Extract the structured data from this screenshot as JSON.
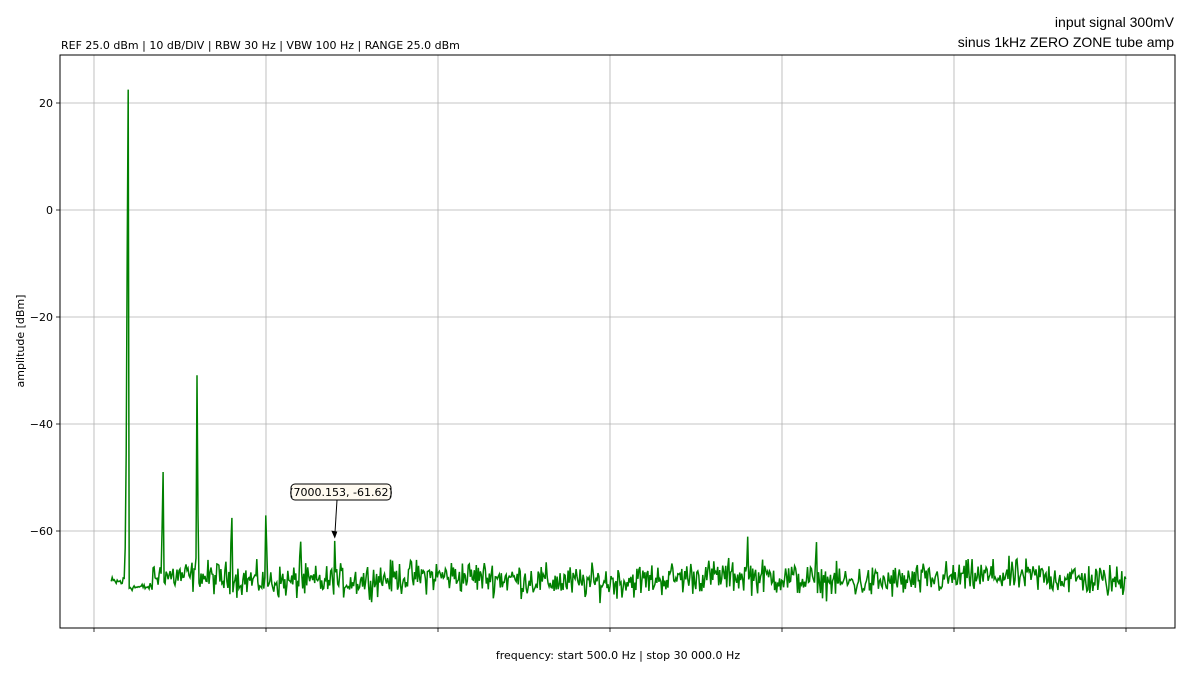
{
  "chart_data": {
    "type": "line",
    "title_left": "REF 25.0 dBm | 10 dB/DIV | RBW 30 Hz | VBW 100 Hz | RANGE 25.0 dBm",
    "title_right": [
      "input signal 300mV",
      "sinus 1kHz ZERO ZONE tube amp"
    ],
    "xlabel": "frequency: start 500.0 Hz | stop 30 000.0 Hz",
    "ylabel": "amplitude [dBm]",
    "xlim": [
      0,
      30500
    ],
    "ylim": [
      -78,
      30
    ],
    "yticks": [
      20,
      0,
      -20,
      -40,
      -60
    ],
    "ytick_labels": [
      "20",
      "0",
      "−20",
      "−40",
      "−60"
    ],
    "xticks": [
      0,
      5000,
      10000,
      15000,
      20000,
      25000,
      30000
    ],
    "grid": true,
    "line_color": "#008000",
    "noise_floor_dbm": -69,
    "series": [
      {
        "x": [
          500,
          1000,
          2000,
          3000,
          4000,
          5000,
          6000,
          7000,
          19000,
          21000
        ],
        "values": [
          -69.5,
          24,
          -46,
          -28.2,
          -55,
          -56.5,
          -60,
          -61.62,
          -61,
          -62
        ]
      }
    ],
    "annotation": {
      "x": 7000.153,
      "y": -61.62,
      "text": "(7000.153, -61.62)"
    }
  }
}
